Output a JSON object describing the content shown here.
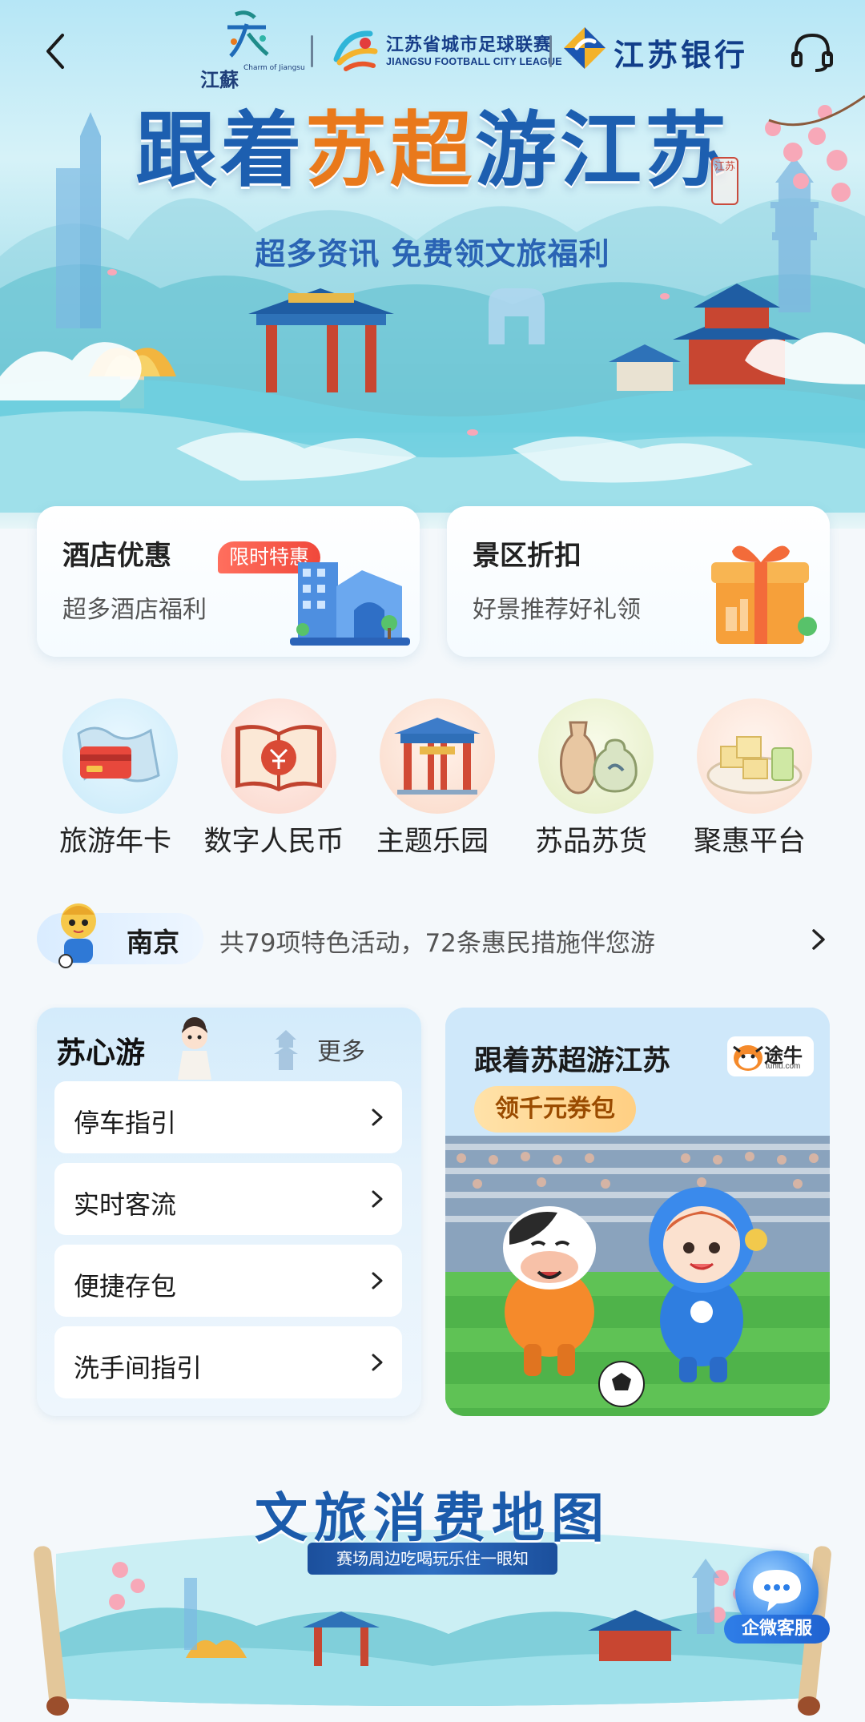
{
  "header": {
    "logo_jiangsu_text": "江蘇",
    "logo_jiangsu_sub": "Charm of Jiangsu",
    "league_cn": "江苏省城市足球联赛",
    "league_en": "JIANGSU FOOTBALL CITY LEAGUE",
    "bank_name": "江苏银行"
  },
  "hero": {
    "title_part1": "跟着",
    "title_accent": "苏超",
    "title_part2": "游江苏",
    "seal_text": "江苏",
    "subtitle": "超多资讯 免费领文旅福利"
  },
  "promos": [
    {
      "title": "酒店优惠",
      "subtitle": "超多酒店福利",
      "tag": "限时特惠"
    },
    {
      "title": "景区折扣",
      "subtitle": "好景推荐好礼领"
    }
  ],
  "grid": [
    {
      "label": "旅游年卡",
      "icon": "travel-card-icon",
      "color": "#d6f0fb"
    },
    {
      "label": "数字人民币",
      "icon": "digital-rmb-book-icon",
      "color": "#fde3dc"
    },
    {
      "label": "主题乐园",
      "icon": "theme-park-gate-icon",
      "color": "#fce6dc"
    },
    {
      "label": "苏品苏货",
      "icon": "pottery-icon",
      "color": "#eef4d7"
    },
    {
      "label": "聚惠平台",
      "icon": "food-plate-icon",
      "color": "#fde8dd"
    }
  ],
  "city_bar": {
    "city": "南京",
    "info": "共79项特色活动，72条惠民措施伴您游"
  },
  "suxinyou": {
    "title": "苏心游",
    "more": "更多",
    "items": [
      "停车指引",
      "实时客流",
      "便捷存包",
      "洗手间指引"
    ]
  },
  "tuniu_banner": {
    "title": "跟着苏超游江苏",
    "coupon": "领千元券包",
    "brand_cn": "途牛",
    "brand_en": "tuniu.com"
  },
  "map_banner": {
    "title": "文旅消费地图",
    "subtitle": "赛场周边吃喝玩乐住一眼知"
  },
  "service": {
    "label": "企微客服"
  }
}
